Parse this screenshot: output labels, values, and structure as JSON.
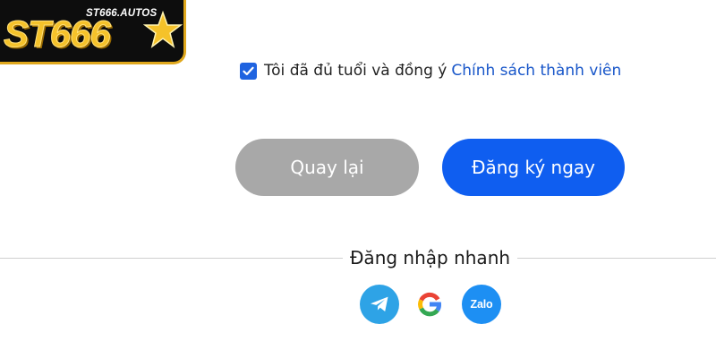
{
  "logo": {
    "wordmark": "ST666",
    "url_text": "ST666.AUTOS",
    "icon": "star-icon",
    "colors": {
      "gold": "#f5c22a",
      "background": "#0d0d0d"
    }
  },
  "agreement": {
    "checked": true,
    "text": "Tôi đã đủ tuổi và đồng ý",
    "link_text": "Chính sách thành viên"
  },
  "buttons": {
    "back_label": "Quay lại",
    "register_label": "Đăng ký ngay"
  },
  "quick_login": {
    "label": "Đăng nhập nhanh",
    "providers": [
      {
        "name": "telegram",
        "icon": "telegram-icon"
      },
      {
        "name": "google",
        "icon": "google-icon"
      },
      {
        "name": "zalo",
        "icon": "zalo-icon",
        "text": "Zalo"
      }
    ]
  },
  "colors": {
    "primary": "#0f5ef0",
    "secondary_button": "#a8a8a8",
    "link": "#1856c9",
    "checkbox": "#1f63e0"
  }
}
